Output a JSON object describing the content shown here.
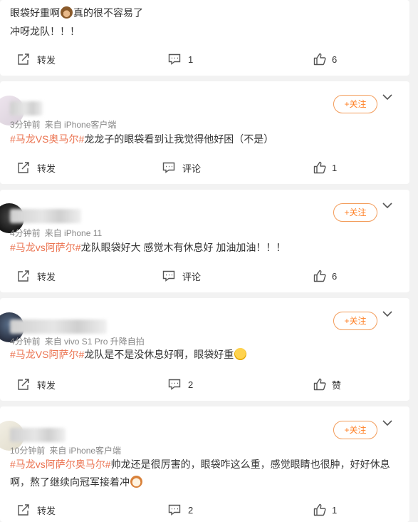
{
  "colors": {
    "accent": "#ff7f24",
    "hashtag": "#eb7350",
    "muted": "#888888"
  },
  "comments": [
    {
      "lines": [
        "眼袋好重啊",
        "真的很不容易了"
      ],
      "line2": "冲呀龙队！！！",
      "emoji": "see-no-evil-monkey-emoji",
      "actions": {
        "share": "转发",
        "comment": "1",
        "like": "6"
      }
    },
    {
      "time": "3分钟前",
      "source": "来自 iPhone客户端",
      "follow": "+关注",
      "hashtag": "#马龙VS奥马尔#",
      "body": "龙龙子的眼袋看到让我觉得他好困（不是）",
      "actions": {
        "share": "转发",
        "comment": "评论",
        "like": "1"
      }
    },
    {
      "time": "4分钟前",
      "source": "来自 iPhone 11",
      "follow": "+关注",
      "hashtag": "#马龙vs阿萨尔#",
      "body": "龙队眼袋好大 感觉木有休息好 加油加油！！！",
      "actions": {
        "share": "转发",
        "comment": "评论",
        "like": "6"
      }
    },
    {
      "time": "4分钟前",
      "source": "来自 vivo S1 Pro 升降自拍",
      "follow": "+关注",
      "hashtag": "#马龙VS阿萨尔#",
      "body": "龙队是不是没休息好啊，眼袋好重",
      "emoji": "laughing-tears-emoji",
      "actions": {
        "share": "转发",
        "comment": "2",
        "like": "赞"
      }
    },
    {
      "time": "10分钟前",
      "source": "来自 iPhone客户端",
      "follow": "+关注",
      "hashtag": "#马龙vs阿萨尔奥马尔#",
      "body": "帅龙还是很厉害的，眼袋咋这么重，感觉眼睛也很肿，好好休息",
      "body2": "啊，熬了继续向冠军接着冲",
      "emoji": "dog-emoji",
      "actions": {
        "share": "转发",
        "comment": "2",
        "like": "1"
      }
    }
  ]
}
